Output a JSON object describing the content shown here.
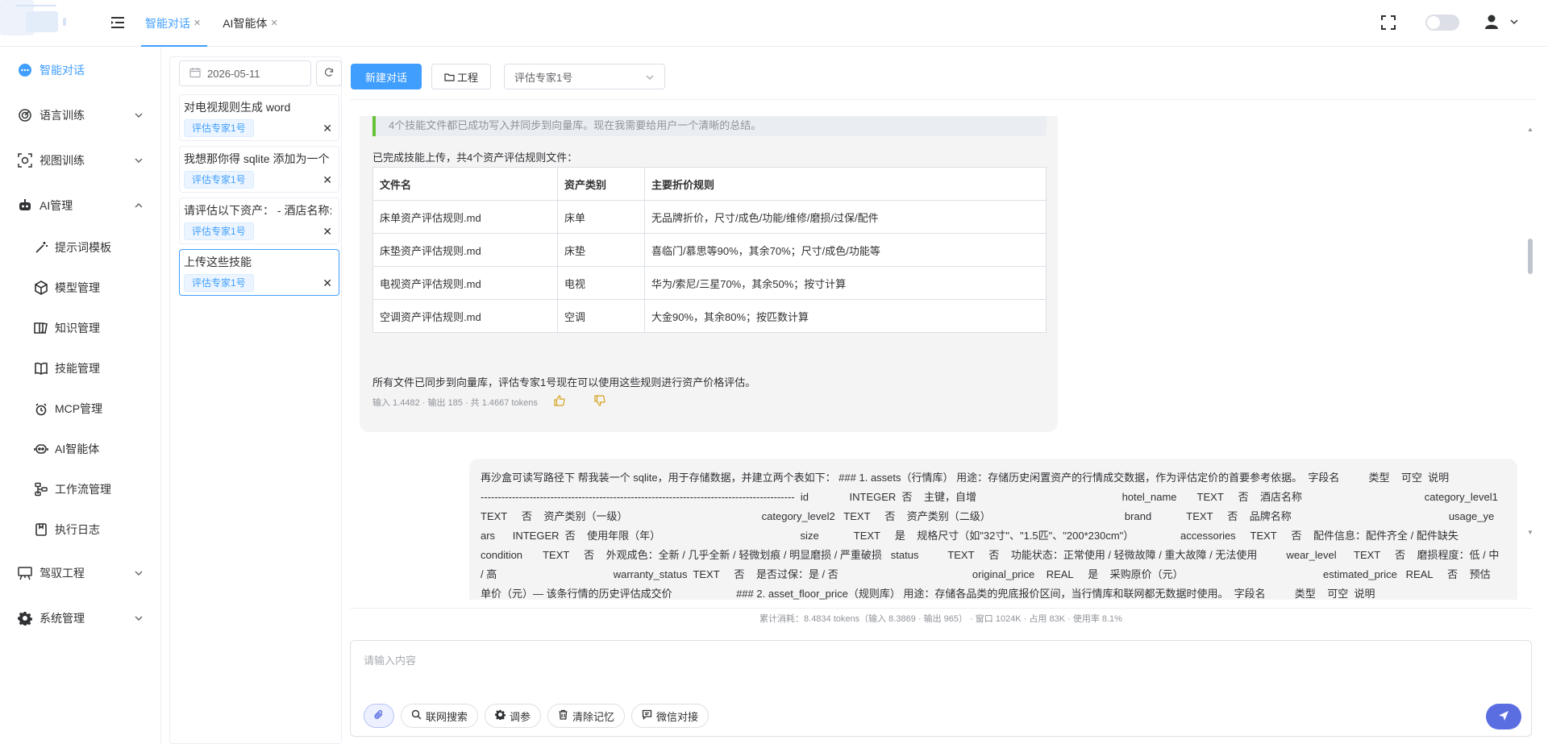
{
  "header": {
    "tabs": [
      {
        "label": "智能对话",
        "active": true
      },
      {
        "label": "AI智能体",
        "active": false
      }
    ],
    "accent_color": "#409eff"
  },
  "sidebar": {
    "items": [
      {
        "label": "智能对话",
        "icon": "chat-bubble-icon"
      },
      {
        "label": "语言训练",
        "icon": "radar-icon"
      },
      {
        "label": "视图训练",
        "icon": "camera-scan-icon"
      },
      {
        "label": "AI管理",
        "icon": "robot-icon",
        "expanded": true
      },
      {
        "label": "驾驭工程",
        "icon": "board-icon"
      },
      {
        "label": "系统管理",
        "icon": "gear-icon"
      }
    ],
    "sub_items": [
      {
        "label": "提示词模板",
        "icon": "magic-wand-icon"
      },
      {
        "label": "模型管理",
        "icon": "cube-icon"
      },
      {
        "label": "知识管理",
        "icon": "book-icon"
      },
      {
        "label": "技能管理",
        "icon": "notebook-icon"
      },
      {
        "label": "MCP管理",
        "icon": "mcp-icon"
      },
      {
        "label": "AI智能体",
        "icon": "bot-face-icon"
      },
      {
        "label": "工作流管理",
        "icon": "workflow-icon"
      },
      {
        "label": "执行日志",
        "icon": "log-icon"
      }
    ]
  },
  "sessions": {
    "date": "2026-05-11",
    "items": [
      {
        "title": "对电视规则生成 word",
        "tag": "评估专家1号",
        "active": false
      },
      {
        "title": "我想那你得 sqlite 添加为一个",
        "tag": "评估专家1号",
        "active": false
      },
      {
        "title": "请评估以下资产： - 酒店名称:",
        "tag": "评估专家1号",
        "active": false
      },
      {
        "title": "上传这些技能",
        "tag": "评估专家1号",
        "active": true
      }
    ]
  },
  "toolbar": {
    "new_chat": "新建对话",
    "project": "工程",
    "agent_select": "评估专家1号"
  },
  "chat": {
    "assistant": {
      "think_text": "4个技能文件都已成功写入并同步到向量库。现在我需要给用户一个清晰的总结。",
      "intro": "已完成技能上传，共4个资产评估规则文件：",
      "table_headers": [
        "文件名",
        "资产类别",
        "主要折价规则"
      ],
      "table_rows": [
        [
          "床单资产评估规则.md",
          "床单",
          "无品牌折价，尺寸/成色/功能/维修/磨损/过保/配件"
        ],
        [
          "床垫资产评估规则.md",
          "床垫",
          "喜临门/慕思等90%，其余70%；尺寸/成色/功能等"
        ],
        [
          "电视资产评估规则.md",
          "电视",
          "华为/索尼/三星70%，其余50%；按寸计算"
        ],
        [
          "空调资产评估规则.md",
          "空调",
          "大金90%，其余80%；按匹数计算"
        ]
      ],
      "outro": "所有文件已同步到向量库，评估专家1号现在可以使用这些规则进行资产价格评估。",
      "tokens": "输入 1.4482 · 输出 185 · 共 1.4667 tokens"
    },
    "user_message": "再沙盒可读写路径下 帮我装一个 sqlite，用于存储数据，并建立两个表如下： ### 1. assets（行情库） 用途：存储历史闲置资产的行情成交数据，作为评估定价的首要参考依据。  字段名          类型    可空  说明                                                        ------------------------------------------------------------------------------------------  id              INTEGER  否    主键，自增                                                  hotel_name       TEXT     否    酒店名称                                          category_level1  TEXT     否    资产类别（一级）                                              category_level2   TEXT     否    资产类别（二级）                                              brand            TEXT     否    品牌名称                                                      usage_years      INTEGER  否    使用年限（年）                                                size            TEXT     是    规格尺寸（如\"32寸\"、\"1.5匹\"、\"200*230cm\"）                accessories     TEXT     否    配件信息：配件齐全 / 配件缺失                                condition       TEXT     否    外观成色：全新 / 几乎全新 / 轻微划痕 / 明显磨损 / 严重破损   status          TEXT     否    功能状态：正常使用 / 轻微故障 / 重大故障 / 无法使用          wear_level      TEXT     否    磨损程度：低 / 中 / 高                                        warranty_status  TEXT     否    是否过保：是 / 否                                              original_price    REAL     是    采购原价（元）                                                estimated_price   REAL     否    预估单价（元）— 该条行情的历史评估成交价                      ### 2. asset_floor_price（规则库） 用途：存储各品类的兜底报价区间，当行情库和联网都无数据时使用。  字段名          类型    可空  说明                                                        ------------------------------------------------------------  id              INTEGER  否    主键，自增                                                  category_level1  TEXT     否    资产类别（一级）     category_level2  TEXT     否    资产类别（二级）     min_price        INTEGER  否    该品类最低报价（元）   max_price        INTEGER  否    该品类"
  },
  "usage": "累计消耗：8.4834 tokens（输入 8.3869 · 输出 965） · 窗口 1024K · 占用 83K · 使用率 8.1%",
  "composer": {
    "placeholder": "请输入内容",
    "chips": [
      "联网搜索",
      "调参",
      "清除记忆",
      "微信对接"
    ],
    "send_color": "#5b6ee1"
  }
}
